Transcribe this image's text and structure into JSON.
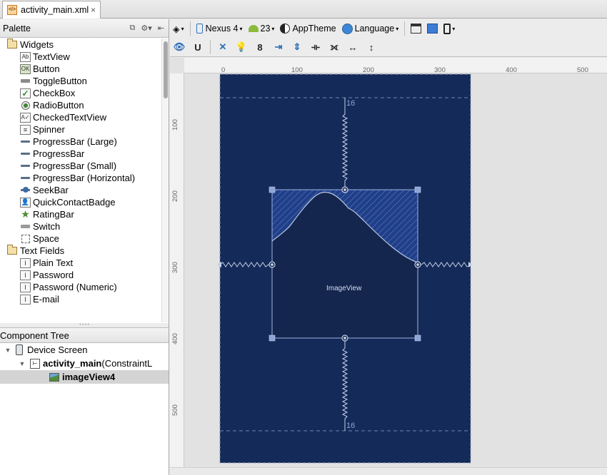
{
  "editor_tab": {
    "filename": "activity_main.xml",
    "close": "×",
    "icon": "xml-file-icon"
  },
  "palette": {
    "title": "Palette",
    "groups": [
      {
        "label": "Widgets",
        "items": [
          "TextView",
          "Button",
          "ToggleButton",
          "CheckBox",
          "RadioButton",
          "CheckedTextView",
          "Spinner",
          "ProgressBar (Large)",
          "ProgressBar",
          "ProgressBar (Small)",
          "ProgressBar (Horizontal)",
          "SeekBar",
          "QuickContactBadge",
          "RatingBar",
          "Switch",
          "Space"
        ]
      },
      {
        "label": "Text Fields",
        "items": [
          "Plain Text",
          "Password",
          "Password (Numeric)",
          "E-mail"
        ]
      }
    ],
    "icon_text": {
      "textview": "Ab",
      "button": "OK",
      "checkedtextview": "A✓"
    }
  },
  "component_tree": {
    "title": "Component Tree",
    "nodes": [
      {
        "label": "Device Screen"
      },
      {
        "label": "activity_main",
        "suffix": " (ConstraintL"
      },
      {
        "label": "imageView4"
      }
    ]
  },
  "toolbar": {
    "device": "Nexus 4",
    "api": "23",
    "theme": "AppTheme",
    "language": "Language",
    "default_margin": "8"
  },
  "rulers": {
    "h": [
      "0",
      "100",
      "200",
      "300",
      "400",
      "500"
    ],
    "v": [
      "100",
      "200",
      "300",
      "400",
      "500"
    ]
  },
  "design": {
    "imageview_label": "ImageView",
    "margin_top": "16",
    "margin_bottom": "16"
  },
  "colors": {
    "screen": "#142a59",
    "imageview": "#14264e",
    "selection": "#9fb3e0"
  }
}
